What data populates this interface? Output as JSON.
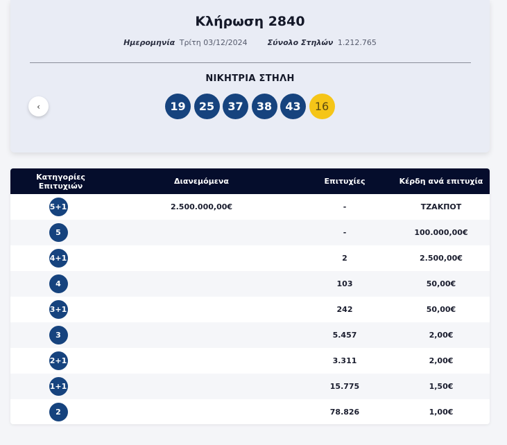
{
  "draw": {
    "title": "Κλήρωση 2840",
    "date_label": "Ημερομηνία",
    "date_value": "Τρίτη 03/12/2024",
    "columns_label": "Σύνολο Στηλών",
    "columns_value": "1.212.765",
    "winning_label": "ΝΙΚΗΤΡΙΑ ΣΤΗΛΗ",
    "prev_icon": "chevron-left-icon",
    "numbers": [
      "19",
      "25",
      "37",
      "38",
      "43"
    ],
    "joker": "16",
    "colors": {
      "ball": "#16437e",
      "joker": "#f5c518",
      "header": "#050d2c"
    }
  },
  "table": {
    "headers": [
      "Κατηγορίες Επιτυχιών",
      "Διανεμόμενα",
      "Επιτυχίες",
      "Κέρδη ανά επιτυχία"
    ],
    "rows": [
      {
        "category": "5+1",
        "distributed": "2.500.000,00€",
        "winners": "-",
        "prize": "ΤΖΑΚΠΟΤ"
      },
      {
        "category": "5",
        "distributed": "",
        "winners": "-",
        "prize": "100.000,00€"
      },
      {
        "category": "4+1",
        "distributed": "",
        "winners": "2",
        "prize": "2.500,00€"
      },
      {
        "category": "4",
        "distributed": "",
        "winners": "103",
        "prize": "50,00€"
      },
      {
        "category": "3+1",
        "distributed": "",
        "winners": "242",
        "prize": "50,00€"
      },
      {
        "category": "3",
        "distributed": "",
        "winners": "5.457",
        "prize": "2,00€"
      },
      {
        "category": "2+1",
        "distributed": "",
        "winners": "3.311",
        "prize": "2,00€"
      },
      {
        "category": "1+1",
        "distributed": "",
        "winners": "15.775",
        "prize": "1,50€"
      },
      {
        "category": "2",
        "distributed": "",
        "winners": "78.826",
        "prize": "1,00€"
      }
    ]
  }
}
